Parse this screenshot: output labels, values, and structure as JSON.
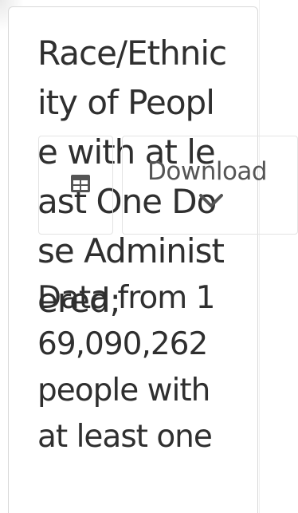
{
  "card": {
    "title": "Race/Ethnicity of People with at least One Dose Administered;",
    "description": "Data from 169,090,262 people with at least one"
  },
  "toolbar": {
    "table_icon": "table-icon",
    "download_label": "Download",
    "download_icon": "chevron-down-icon"
  },
  "colors": {
    "text": "#2f2f2f",
    "border": "#d9d9d9",
    "icon": "#555555"
  }
}
